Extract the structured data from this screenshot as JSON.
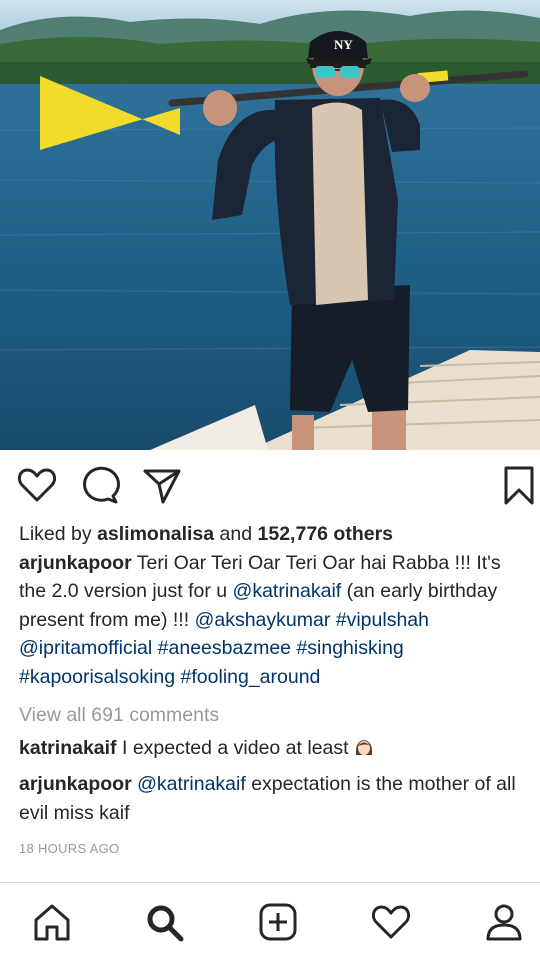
{
  "post": {
    "likes": {
      "prefix": "Liked by",
      "user": "aslimonalisa",
      "joiner": "and",
      "count": "152,776 others"
    },
    "caption": {
      "author": "arjunkapoor",
      "text_1": "Teri Oar Teri Oar Teri Oar hai Rabba !!! It's the 2.0 version just for u",
      "mention_1": "@katrinakaif",
      "text_2": "(an early birthday present from me) !!!",
      "mention_2": "@akshaykumar",
      "hashtag_1": "#vipulshah",
      "mention_3": "@ipritamofficial",
      "mention_4": "#aneesbazmee",
      "hashtag_2": "#singhisking",
      "hashtag_3": "#kapoorisalsoking",
      "hashtag_4": "#fooling_around"
    },
    "view_all_comments": "View all 691 comments",
    "comments": [
      {
        "user": "katrinakaif",
        "text": "I expected a video at least"
      },
      {
        "user": "arjunkapoor",
        "mention": "@katrinakaif",
        "text": "expectation is the mother of all evil miss kaif"
      }
    ],
    "timestamp": "18 HOURS AGO",
    "cap_logo": "NY"
  },
  "action_icons": [
    "heart-icon",
    "comment-icon",
    "share-icon",
    "bookmark-icon"
  ],
  "tab_icons": [
    "home-icon",
    "search-icon",
    "add-icon",
    "heart-icon",
    "profile-icon"
  ],
  "colors": {
    "link": "#003569",
    "muted": "#999999",
    "text": "#262626"
  }
}
